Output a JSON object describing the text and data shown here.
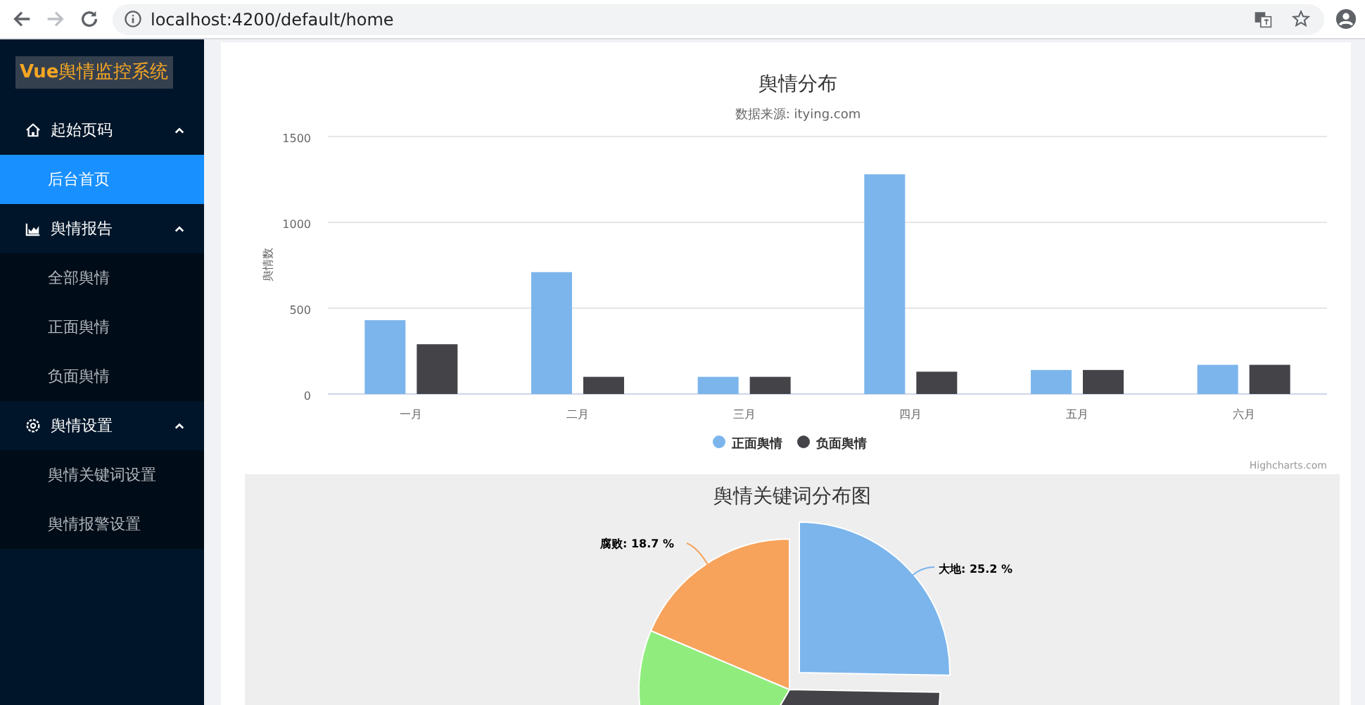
{
  "browser": {
    "url": "localhost:4200/default/home"
  },
  "sidebar": {
    "logo": "**Vue**舆情监控系统",
    "groups": [
      {
        "label": "起始页码",
        "kind": "home",
        "expanded": true,
        "items": [
          {
            "label": "后台首页",
            "selected": true
          }
        ]
      },
      {
        "label": "舆情报告",
        "kind": "report",
        "expanded": true,
        "items": [
          {
            "label": "全部舆情",
            "selected": false
          },
          {
            "label": "正面舆情",
            "selected": false
          },
          {
            "label": "负面舆情",
            "selected": false
          }
        ]
      },
      {
        "label": "舆情设置",
        "kind": "settings",
        "expanded": true,
        "items": [
          {
            "label": "舆情关键词设置",
            "selected": false
          },
          {
            "label": "舆情报警设置",
            "selected": false
          }
        ]
      }
    ]
  },
  "bar_panel": {
    "subtitle": "数据来源: itying.com",
    "credit": "Highcharts.com",
    "chart_data": {
      "type": "bar",
      "title": "舆情分布",
      "ylabel": "舆情数",
      "categories": [
        "一月",
        "二月",
        "三月",
        "四月",
        "五月",
        "六月"
      ],
      "series": [
        {
          "name": "正面舆情",
          "color": "#7cb5ec",
          "values": [
            430,
            710,
            100,
            1280,
            140,
            170
          ]
        },
        {
          "name": "负面舆情",
          "color": "#434348",
          "values": [
            290,
            100,
            100,
            130,
            140,
            170
          ]
        }
      ],
      "legend": "bottom",
      "ylim": [
        0,
        1500
      ],
      "yticks": [
        0,
        500,
        1000,
        1500
      ]
    }
  },
  "pie_panel": {
    "title": "舆情关键词分布图",
    "slices": [
      {
        "label": "大地: 25.2 %",
        "color": "#7cb5ec"
      },
      {
        "color": "#434348"
      },
      {
        "color": "#90ed7d"
      },
      {
        "label": "腐败: 18.7 %",
        "color": "#f7a35c"
      }
    ]
  }
}
